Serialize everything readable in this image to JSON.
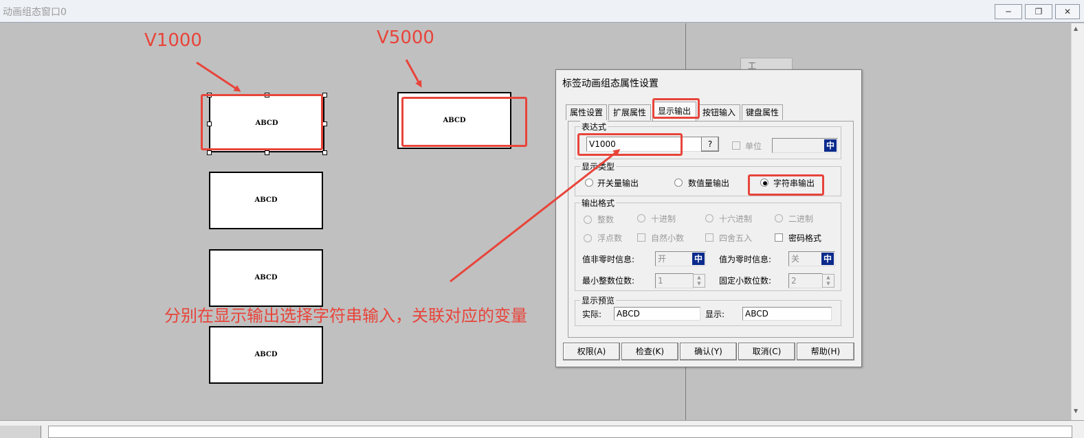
{
  "window": {
    "title": "动画组态窗口0",
    "minimize_icon": "minimize-icon",
    "restore_icon": "restore-icon",
    "close_icon": "close-icon"
  },
  "canvas": {
    "labels": [
      "ABCD",
      "ABCD",
      "ABCD",
      "ABCD",
      "ABCD"
    ]
  },
  "annotations": {
    "v1000": "V1000",
    "v5000": "V5000",
    "note": "分别在显示输出选择字符串输入，关联对应的变量",
    "accent_color": "#e8443a"
  },
  "floating_tool": {
    "label": "工"
  },
  "dialog": {
    "title": "标签动画组态属性设置",
    "tabs": [
      "属性设置",
      "扩展属性",
      "显示输出",
      "按钮输入",
      "键盘属性"
    ],
    "active_tab": "显示输出",
    "expression": {
      "group_title": "表达式",
      "value": "V1000",
      "browse_label": "?",
      "unit_label": "单位",
      "unit_value": "",
      "ime_label": "中"
    },
    "display_type": {
      "group_title": "显示类型",
      "options": [
        "开关量输出",
        "数值量输出",
        "字符串输出"
      ],
      "selected": "字符串输出"
    },
    "output_format": {
      "group_title": "输出格式",
      "radios_row1": [
        "整数",
        "十进制",
        "十六进制",
        "二进制"
      ],
      "row2_radio": "浮点数",
      "row2_checks": [
        "自然小数",
        "四舍五入",
        "密码格式"
      ],
      "nonzero_label": "值非零时信息:",
      "nonzero_value": "开",
      "zero_label": "值为零时信息:",
      "zero_value": "关",
      "min_int_label": "最小整数位数:",
      "min_int_value": "1",
      "fixed_dec_label": "固定小数位数:",
      "fixed_dec_value": "2",
      "ime_label": "中"
    },
    "preview": {
      "group_title": "显示预览",
      "actual_label": "实际:",
      "actual_value": "ABCD",
      "display_label": "显示:",
      "display_value": "ABCD"
    },
    "buttons": [
      "权限(A)",
      "检查(K)",
      "确认(Y)",
      "取消(C)",
      "帮助(H)"
    ]
  }
}
